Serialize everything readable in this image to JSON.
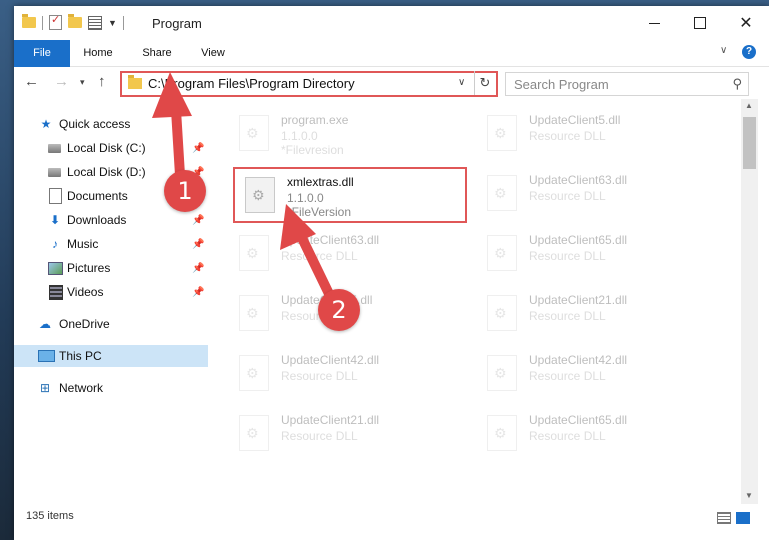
{
  "window": {
    "title": "Program",
    "controls": {
      "minimize": "minimize",
      "maximize": "maximize",
      "close": "✕"
    }
  },
  "ribbon": {
    "tabs": [
      {
        "label": "File"
      },
      {
        "label": "Home"
      },
      {
        "label": "Share"
      },
      {
        "label": "View"
      }
    ],
    "help": "?"
  },
  "address": {
    "path": "C:\\Program Files\\Program Directory"
  },
  "search": {
    "placeholder": "Search Program"
  },
  "nav_pane": {
    "items": [
      {
        "label": "Quick access",
        "icon": "star-icon"
      },
      {
        "label": "Local Disk (C:)",
        "icon": "disk-icon",
        "pinned": true
      },
      {
        "label": "Local Disk (D:)",
        "icon": "disk-icon",
        "pinned": true
      },
      {
        "label": "Documents",
        "icon": "document-icon",
        "pinned": true
      },
      {
        "label": "Downloads",
        "icon": "download-icon",
        "pinned": true
      },
      {
        "label": "Music",
        "icon": "music-icon",
        "pinned": true
      },
      {
        "label": "Pictures",
        "icon": "picture-icon",
        "pinned": true
      },
      {
        "label": "Videos",
        "icon": "video-icon",
        "pinned": true
      },
      {
        "label": "OneDrive",
        "icon": "cloud-icon"
      },
      {
        "label": "This PC",
        "icon": "computer-icon",
        "selected": true
      },
      {
        "label": "Network",
        "icon": "network-icon"
      }
    ]
  },
  "files": {
    "left": [
      {
        "name": "program.exe",
        "line1": "1.1.0.0",
        "line2": "*Filevresion"
      },
      {
        "name": "xmlextras.dll",
        "line1": "1.1.0.0",
        "line2": "*FileVersion",
        "highlighted": true
      },
      {
        "name": "UpdateClient63.dll",
        "line1": "Resource DLL"
      },
      {
        "name": "UpdateClient5.dll",
        "line1": "Resource DLL"
      },
      {
        "name": "UpdateClient42.dll",
        "line1": "Resource DLL"
      },
      {
        "name": "UpdateClient21.dll",
        "line1": "Resource DLL"
      }
    ],
    "right": [
      {
        "name": "UpdateClient5.dll",
        "line1": "Resource DLL"
      },
      {
        "name": "UpdateClient63.dll",
        "line1": "Resource DLL"
      },
      {
        "name": "UpdateClient65.dll",
        "line1": "Resource DLL"
      },
      {
        "name": "UpdateClient21.dll",
        "line1": "Resource DLL"
      },
      {
        "name": "UpdateClient42.dll",
        "line1": "Resource DLL"
      },
      {
        "name": "UpdateClient65.dll",
        "line1": "Resource DLL"
      }
    ]
  },
  "status": {
    "count": "135 items"
  },
  "annotations": {
    "step1": "1",
    "step2": "2",
    "color": "#e04848"
  }
}
